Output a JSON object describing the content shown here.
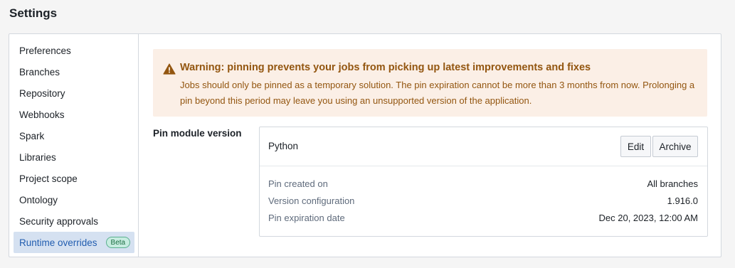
{
  "page": {
    "title": "Settings"
  },
  "sidebar": {
    "items": [
      {
        "label": "Preferences"
      },
      {
        "label": "Branches"
      },
      {
        "label": "Repository"
      },
      {
        "label": "Webhooks"
      },
      {
        "label": "Spark"
      },
      {
        "label": "Libraries"
      },
      {
        "label": "Project scope"
      },
      {
        "label": "Ontology"
      },
      {
        "label": "Security approvals"
      },
      {
        "label": "Runtime overrides",
        "badge": "Beta",
        "active": true
      }
    ]
  },
  "warning": {
    "icon": "warning-triangle-icon",
    "title": "Warning: pinning prevents your jobs from picking up latest improvements and fixes",
    "body": "Jobs should only be pinned as a temporary solution. The pin expiration cannot be more than 3 months from now. Prolonging a pin beyond this period may leave you using an unsupported version of the application.",
    "color": "#935610",
    "background": "#fbefe6"
  },
  "pin": {
    "section_label": "Pin module version",
    "card_title": "Python",
    "edit_label": "Edit",
    "archive_label": "Archive",
    "rows": [
      {
        "label": "Pin created on",
        "value": "All branches"
      },
      {
        "label": "Version configuration",
        "value": "1.916.0"
      },
      {
        "label": "Pin expiration date",
        "value": "Dec 20, 2023, 12:00 AM"
      }
    ]
  },
  "colors": {
    "accent": "#215db0",
    "active_bg": "#d5e1f1",
    "beta_bg": "#c7ece0"
  }
}
